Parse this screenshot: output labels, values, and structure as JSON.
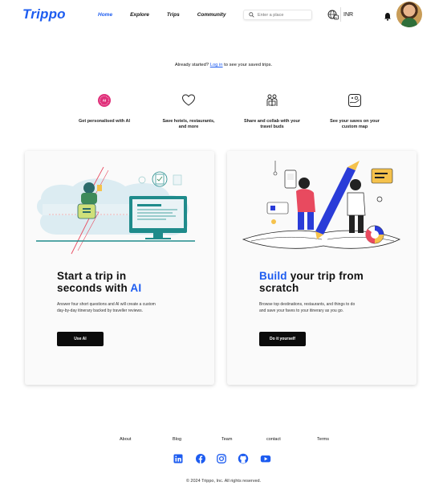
{
  "header": {
    "logo": "Trippo",
    "nav": [
      {
        "label": "Home",
        "active": true
      },
      {
        "label": "Explore",
        "active": false
      },
      {
        "label": "Trips",
        "active": false
      },
      {
        "label": "Community",
        "active": false
      }
    ],
    "search_placeholder": "Enter a place",
    "currency": "INR",
    "icons": [
      "search-icon",
      "globe-language-icon",
      "bell-icon",
      "user-avatar"
    ]
  },
  "already": {
    "prefix": "Already started?",
    "login": "Log in",
    "suffix": "to see your saved trips."
  },
  "features": [
    {
      "icon": "ai-badge-icon",
      "text": "Get personalised with AI"
    },
    {
      "icon": "heart-icon",
      "text": "Save hotels, restaurants, and more"
    },
    {
      "icon": "people-collab-icon",
      "text": "Share and collab with your travel buds"
    },
    {
      "icon": "map-icon",
      "text": "See your saves on your custom map"
    }
  ],
  "cards": [
    {
      "title_line1": "Start a trip in",
      "title_line2_prefix": "seconds with ",
      "title_line2_highlight": "AI",
      "description": "Answer four short questions and AI will create a custom day-by-day itinerary backed by traveller reviews.",
      "cta": "Use AI"
    },
    {
      "title_highlight": "Build",
      "title_rest_line1": " your trip from",
      "title_line2": "scratch",
      "description": "Browse top destinations, restaurants, and things to do and save your faves to your itinerary as you go.",
      "cta": "Do it yourself"
    }
  ],
  "footer": {
    "links": [
      "About",
      "Blog",
      "Team",
      "contact",
      "Terms"
    ],
    "socials": [
      "linkedin-icon",
      "facebook-icon",
      "instagram-icon",
      "github-icon",
      "youtube-icon"
    ],
    "copyright": "© 2024 Trippo, Inc. All rights reserved."
  },
  "colors": {
    "brand": "#1d5cf0",
    "button": "#0b0b0b",
    "ai_icon": "#e0307a"
  }
}
